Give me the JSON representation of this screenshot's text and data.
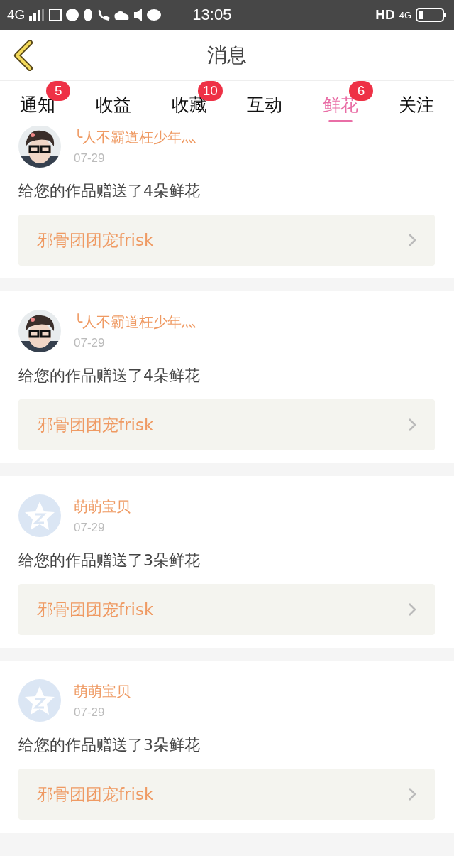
{
  "status_bar": {
    "network": "4G",
    "time": "13:05",
    "hd": "HD",
    "network_right": "4G"
  },
  "header": {
    "title": "消息"
  },
  "tabs": [
    {
      "label": "通知",
      "badge": "5",
      "selected": false
    },
    {
      "label": "收益",
      "selected": false
    },
    {
      "label": "收藏",
      "badge": "10",
      "selected": false
    },
    {
      "label": "互动",
      "selected": false
    },
    {
      "label": "鲜花",
      "badge": "6",
      "selected": true
    },
    {
      "label": "关注",
      "selected": false
    }
  ],
  "messages": [
    {
      "user": "╰人不霸道枉少年灬",
      "date": "07-29",
      "text": "给您的作品赠送了4朵鲜花",
      "work": "邪骨团团宠frisk"
    },
    {
      "user": "╰人不霸道枉少年灬",
      "date": "07-29",
      "text": "给您的作品赠送了4朵鲜花",
      "work": "邪骨团团宠frisk"
    },
    {
      "kind": "default",
      "user": "萌萌宝贝",
      "date": "07-29",
      "text": "给您的作品赠送了3朵鲜花",
      "work": "邪骨团团宠frisk"
    },
    {
      "kind": "default",
      "user": "萌萌宝贝",
      "date": "07-29",
      "text": "给您的作品赠送了3朵鲜花",
      "work": "邪骨团团宠frisk"
    }
  ]
}
